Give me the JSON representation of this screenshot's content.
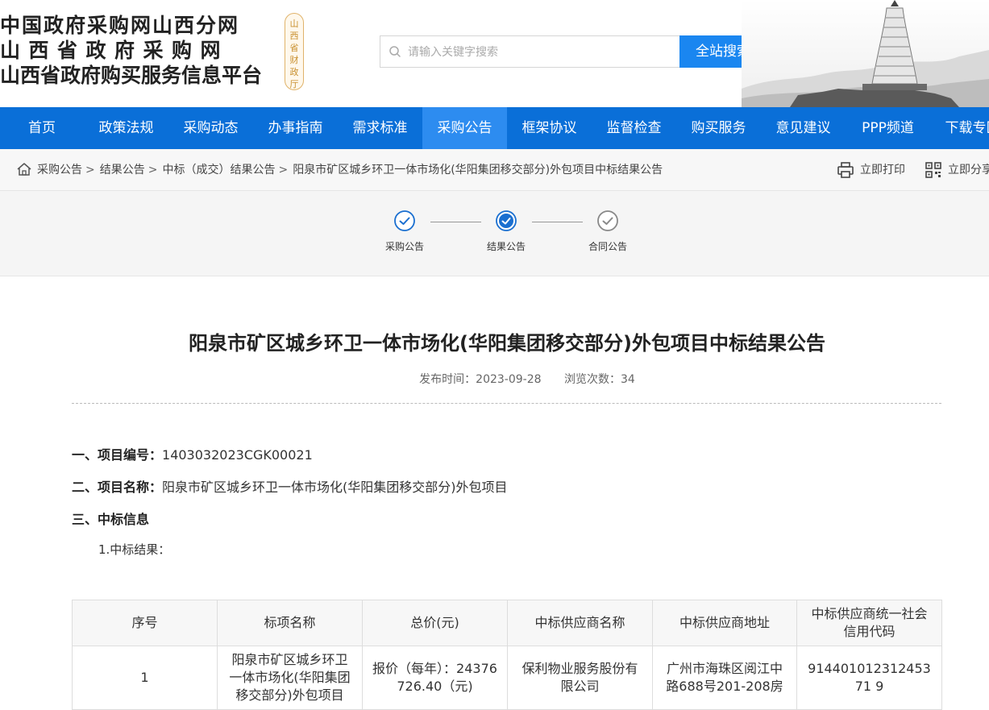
{
  "header": {
    "title_lines": [
      "中国政府采购网山西分网",
      "山西省政府采购网",
      "山西省政府购买服务信息平台"
    ],
    "seal_chars": [
      "山",
      "西",
      "省",
      "财",
      "政",
      "厅"
    ],
    "search_placeholder": "请输入关键字搜索",
    "search_button": "全站搜索"
  },
  "nav": {
    "items": [
      {
        "label": "首页"
      },
      {
        "label": "政策法规"
      },
      {
        "label": "采购动态"
      },
      {
        "label": "办事指南"
      },
      {
        "label": "需求标准"
      },
      {
        "label": "采购公告"
      },
      {
        "label": "框架协议"
      },
      {
        "label": "监督检查"
      },
      {
        "label": "购买服务"
      },
      {
        "label": "意见建议"
      },
      {
        "label": "PPP频道"
      },
      {
        "label": "下载专区"
      }
    ],
    "active_index": 5
  },
  "breadcrumb": {
    "items": [
      "采购公告",
      "结果公告",
      "中标（成交）结果公告",
      "阳泉市矿区城乡环卫一体市场化(华阳集团移交部分)外包项目中标结果公告"
    ],
    "separator": ">",
    "print_label": "立即打印",
    "share_label": "立即分享"
  },
  "steps": [
    {
      "label": "采购公告",
      "state": "done"
    },
    {
      "label": "结果公告",
      "state": "current"
    },
    {
      "label": "合同公告",
      "state": "pending"
    }
  ],
  "article": {
    "title": "阳泉市矿区城乡环卫一体市场化(华阳集团移交部分)外包项目中标结果公告",
    "publish_label": "发布时间：",
    "publish_date": "2023-09-28",
    "views_label": "浏览次数：",
    "views": "34",
    "sections": {
      "s1_label": "一、项目编号：",
      "s1_value": "1403032023CGK00021",
      "s2_label": "二、项目名称：",
      "s2_value": "阳泉市矿区城乡环卫一体市场化(华阳集团移交部分)外包项目",
      "s3_label": "三、中标信息",
      "s3_sub": "1.中标结果："
    },
    "table": {
      "headers": [
        "序号",
        "标项名称",
        "总价(元)",
        "中标供应商名称",
        "中标供应商地址",
        "中标供应商统一社会信用代码"
      ],
      "rows": [
        [
          "1",
          "阳泉市矿区城乡环卫一体市场化(华阳集团移交部分)外包项目",
          "报价（每年）：24376726.40（元)",
          "保利物业服务股份有限公司",
          "广州市海珠区阅江中路688号201-208房",
          "91440101231245371 9"
        ]
      ]
    }
  },
  "colors": {
    "nav_bg": "#0a6fd8",
    "nav_active": "#2d8cf0",
    "search_button": "#1a86f0",
    "step_done": "#1a6fd0",
    "step_pending": "#888888"
  }
}
